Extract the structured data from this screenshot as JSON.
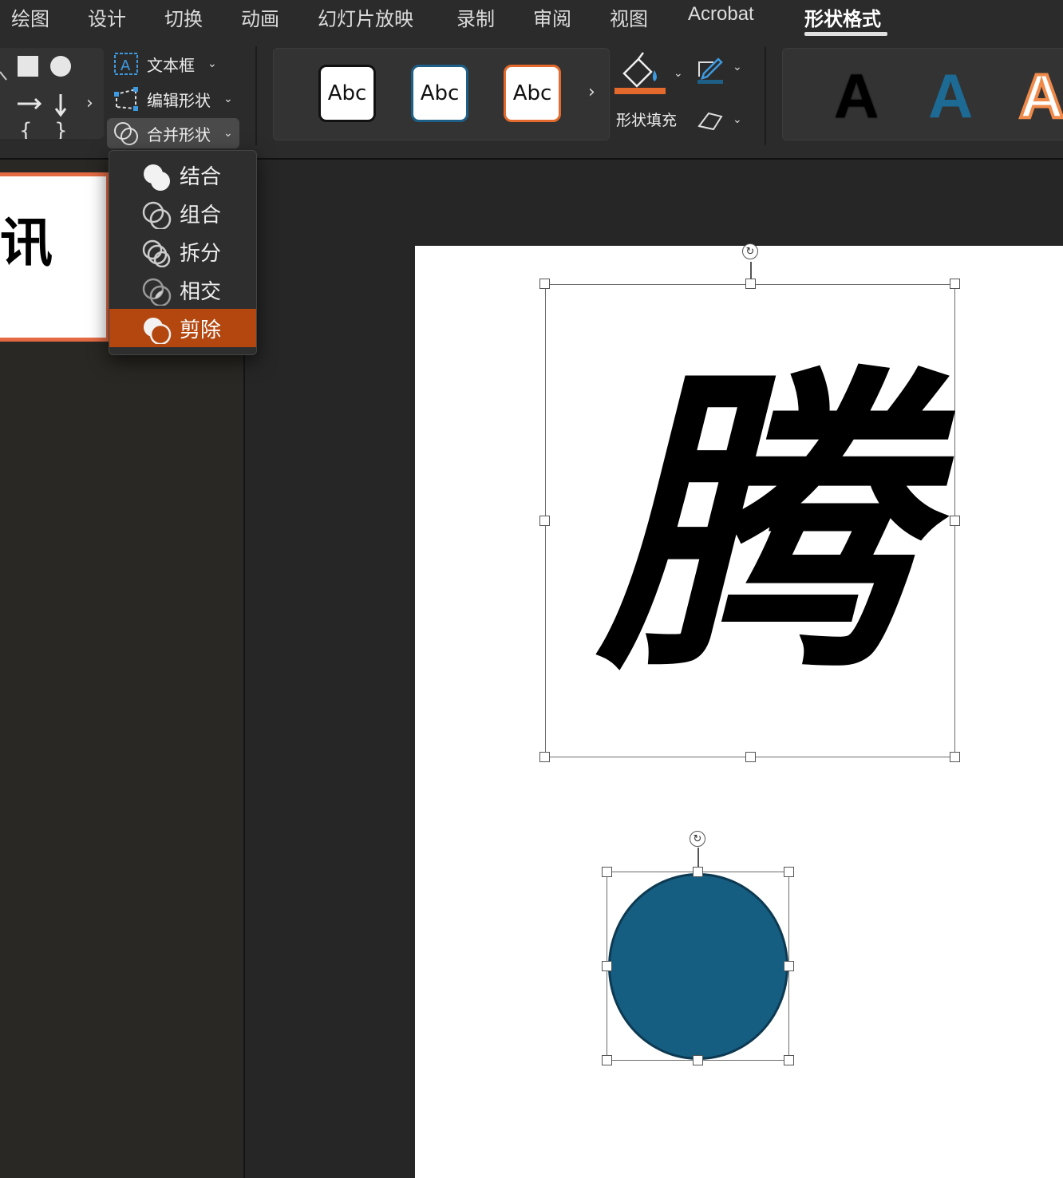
{
  "menubar": {
    "items": [
      "绘图",
      "设计",
      "切换",
      "动画",
      "幻灯片放映",
      "录制",
      "审阅",
      "视图",
      "Acrobat",
      "形状格式"
    ],
    "active": "形状格式"
  },
  "ribbon": {
    "insert": {
      "textbox_label": "文本框",
      "edit_shape_label": "编辑形状",
      "merge_shapes_label": "合并形状"
    },
    "shape_styles": {
      "preset_labels": [
        "Abc",
        "Abc",
        "Abc"
      ],
      "preset_border_colors": [
        "#111111",
        "#1d5f86",
        "#e36a2c"
      ]
    },
    "fill": {
      "label": "形状填充",
      "color": "#e36a2c"
    },
    "wordart": {
      "letters": [
        "A",
        "A",
        "A"
      ],
      "colors": [
        "#000000",
        "#1d6a95",
        "#f08a4b"
      ]
    }
  },
  "merge_menu": {
    "items": [
      {
        "label": "结合",
        "icon": "union-icon"
      },
      {
        "label": "组合",
        "icon": "combine-icon"
      },
      {
        "label": "拆分",
        "icon": "fragment-icon"
      },
      {
        "label": "相交",
        "icon": "intersect-icon"
      },
      {
        "label": "剪除",
        "icon": "subtract-icon"
      }
    ],
    "selected": "剪除"
  },
  "thumbnail": {
    "text": "讯"
  },
  "slide": {
    "glyph": "腾",
    "circle_color": "#155e82"
  },
  "colors": {
    "accent": "#e36a43",
    "menu_selected": "#b3470f"
  }
}
